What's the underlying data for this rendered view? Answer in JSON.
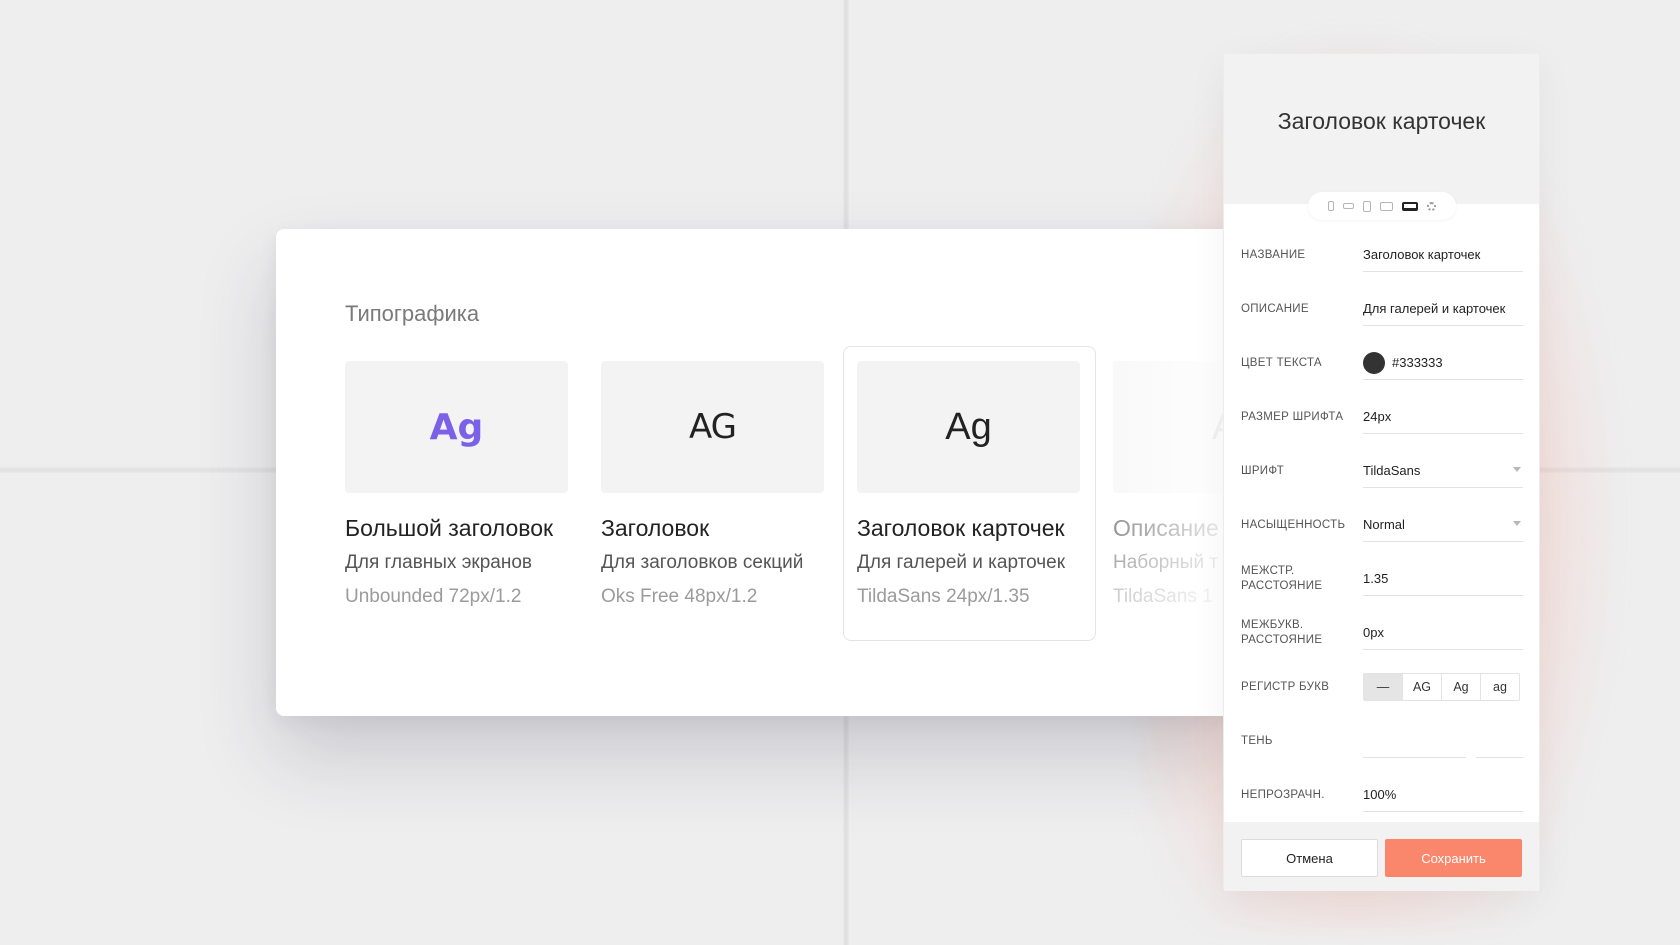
{
  "colors": {
    "accent": "#fa876b",
    "brand_purple": "#7b61e8",
    "text_color_value": "#333333"
  },
  "card": {
    "title": "Типографика",
    "tiles": [
      {
        "preview": "Ag",
        "name": "Большой заголовок",
        "desc": "Для главных экранов",
        "meta": "Unbounded 72px/1.2"
      },
      {
        "preview": "AG",
        "name": "Заголовок",
        "desc": "Для заголовков секций",
        "meta": "Oks Free 48px/1.2"
      },
      {
        "preview": "Ag",
        "name": "Заголовок карточек",
        "desc": "Для галерей и карточек",
        "meta": "TildaSans 24px/1.35"
      },
      {
        "preview": "A",
        "name": "Описание",
        "desc": "Наборный т",
        "meta": "TildaSans 1"
      }
    ]
  },
  "panel": {
    "title": "Заголовок карточек",
    "devices": [
      "phone-portrait-icon",
      "phone-landscape-icon",
      "tablet-portrait-icon",
      "tablet-landscape-icon",
      "laptop-icon",
      "settings-icon"
    ],
    "fields": {
      "name": {
        "label": "Название",
        "value": "Заголовок карточек"
      },
      "description": {
        "label": "Описание",
        "value": "Для галерей и карточек"
      },
      "text_color": {
        "label": "Цвет текста",
        "value": "#333333"
      },
      "font_size": {
        "label": "Размер шрифта",
        "value": "24px"
      },
      "font": {
        "label": "Шрифт",
        "value": "TildaSans"
      },
      "weight": {
        "label": "Насыщенность",
        "value": "Normal"
      },
      "line_height": {
        "label": "Межстр. расстояние",
        "value": "1.35"
      },
      "letter_spacing": {
        "label": "Межбукв. расстояние",
        "value": "0px"
      },
      "text_case": {
        "label": "Регистр букв",
        "options": [
          "—",
          "AG",
          "Ag",
          "ag"
        ],
        "selected": "—"
      },
      "shadow": {
        "label": "Тень"
      },
      "opacity": {
        "label": "Непрозрачн.",
        "value": "100%"
      }
    },
    "cancel_label": "Отмена",
    "save_label": "Сохранить"
  }
}
